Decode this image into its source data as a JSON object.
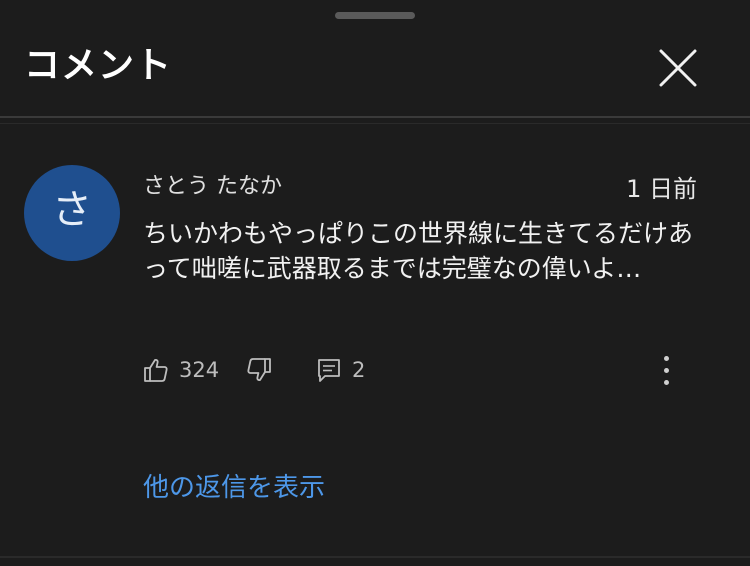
{
  "header": {
    "title": "コメント",
    "close_icon": "close-icon"
  },
  "comment": {
    "avatar_letter": "さ",
    "author": "さとう たなか",
    "time": "1 日前",
    "text": "ちいかわもやっぱりこの世界線に生きてるだけあって咄嗟に武器取るまでは完璧なの偉いよ…",
    "like_count": "324",
    "reply_count": "2"
  },
  "replies": {
    "show_label": "他の返信を表示"
  },
  "colors": {
    "background": "#1c1c1c",
    "avatar": "#1f4f8f",
    "link": "#4d97e8"
  }
}
